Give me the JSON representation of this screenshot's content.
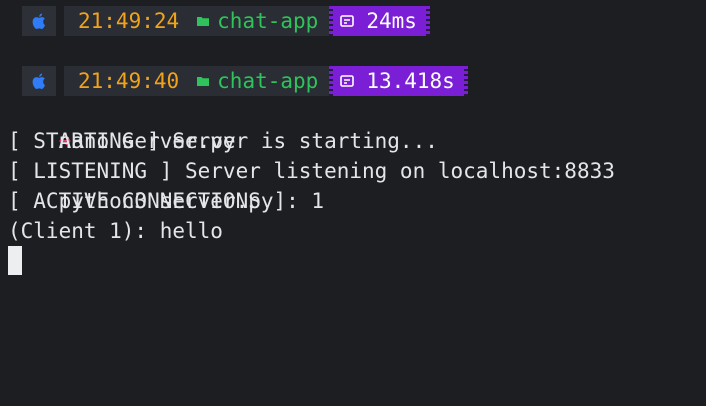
{
  "blocks": [
    {
      "time": "21:49:24",
      "directory": "chat-app",
      "duration": "24ms",
      "prompt_symbol": "➜",
      "command": "nano server.py"
    },
    {
      "time": "21:49:40",
      "directory": "chat-app",
      "duration": "13.418s",
      "prompt_symbol": "➜",
      "command": "python3 server.py"
    }
  ],
  "output": [
    "[ STARTING ] Server is starting...",
    "[ LISTENING ] Server listening on localhost:8833",
    "[ ACTIVE CONNECTIONS ]: 1",
    "(Client 1): hello"
  ],
  "colors": {
    "background": "#1c1e22",
    "time": "#f2a31a",
    "directory": "#2ec45b",
    "duration_bg": "#7a1fd6",
    "prompt_arrow": "#e63c6a"
  },
  "icons": {
    "os": "apple-icon",
    "directory": "folder-icon",
    "duration": "timer-icon"
  }
}
